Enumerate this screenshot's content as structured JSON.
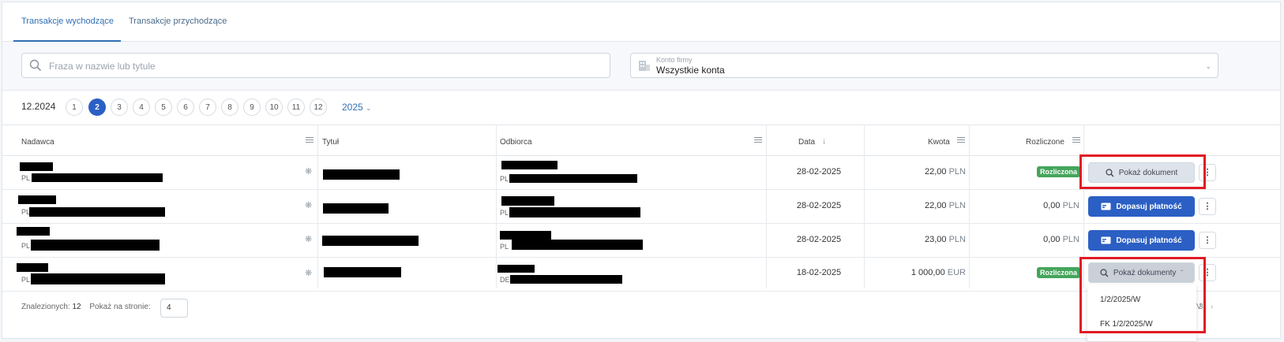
{
  "tabs": [
    {
      "label": "Transakcje wychodzące",
      "active": true
    },
    {
      "label": "Transakcje przychodzące",
      "active": false
    }
  ],
  "search": {
    "placeholder": "Fraza w nazwie lub tytule",
    "value": ""
  },
  "account_select": {
    "label": "Konto firmy",
    "value": "Wszystkie konta"
  },
  "month_pager": {
    "prev_period": "12.2024",
    "months": [
      "1",
      "2",
      "3",
      "4",
      "5",
      "6",
      "7",
      "8",
      "9",
      "10",
      "11",
      "12"
    ],
    "active_month": "2",
    "year": "2025"
  },
  "table": {
    "columns": [
      "Nadawca",
      "Tytuł",
      "Odbiorca",
      "Data",
      "Kwota",
      "Rozliczone"
    ],
    "rows": [
      {
        "sender_country": "PL",
        "recipient_country": "PL",
        "date": "28-02-2025",
        "amount": "22,00",
        "currency": "PLN",
        "settled": "",
        "settled_currency": "",
        "status": "Rozliczona",
        "action": "Pokaż dokument",
        "action_type": "documents"
      },
      {
        "sender_country": "PL",
        "recipient_country": "PL",
        "date": "28-02-2025",
        "amount": "22,00",
        "currency": "PLN",
        "settled": "0,00",
        "settled_currency": "PLN",
        "status": "",
        "action": "Dopasuj płatność",
        "action_type": "match"
      },
      {
        "sender_country": "PL",
        "recipient_country": "PL",
        "date": "28-02-2025",
        "amount": "23,00",
        "currency": "PLN",
        "settled": "0,00",
        "settled_currency": "PLN",
        "status": "",
        "action": "Dopasuj płatność",
        "action_type": "match"
      },
      {
        "sender_country": "PL",
        "recipient_country": "DE",
        "date": "18-02-2025",
        "amount": "1 000,00",
        "currency": "EUR",
        "settled": "",
        "settled_currency": "",
        "status": "Rozliczona",
        "action": "Pokaż dokumenty",
        "action_type": "documents"
      }
    ]
  },
  "footer": {
    "found_label": "Znalezionych:",
    "found_count": "12",
    "page_size_label": "Pokaż na stronie:",
    "page_size": "4",
    "tail_left": "V",
    "tail_right": "3"
  },
  "dropdown": {
    "items": [
      "1/2/2025/W",
      "FK 1/2/2025/W"
    ]
  },
  "colors": {
    "primary": "#2b5fc4",
    "success": "#44a55b",
    "highlight": "#e01b24"
  }
}
